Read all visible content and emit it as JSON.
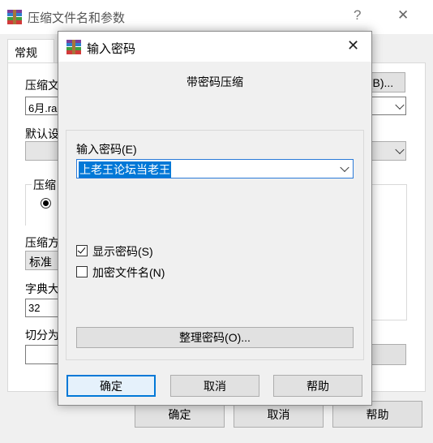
{
  "parent": {
    "title": "压缩文件名和参数",
    "help_glyph": "?",
    "close_glyph": "✕",
    "tab_general": "常规",
    "archive_name_label": "压缩文",
    "archive_name_value": "6月.ra",
    "browse_label": "(B)...",
    "default_label": "默认设",
    "format_label": "压缩",
    "method_label": "压缩方",
    "method_value": "标准",
    "dict_label": "字典大",
    "dict_value": "32",
    "split_label": "切分为",
    "ok": "确定",
    "cancel": "取消",
    "help": "帮助"
  },
  "dialog": {
    "title": "输入密码",
    "close_glyph": "✕",
    "subtitle": "带密码压缩",
    "password_label": "输入密码(E)",
    "password_value": "上老王论坛当老王",
    "show_password": "显示密码(S)",
    "show_password_checked": true,
    "encrypt_names": "加密文件名(N)",
    "encrypt_names_checked": false,
    "organize_button": "整理密码(O)...",
    "ok": "确定",
    "cancel": "取消",
    "help": "帮助"
  }
}
